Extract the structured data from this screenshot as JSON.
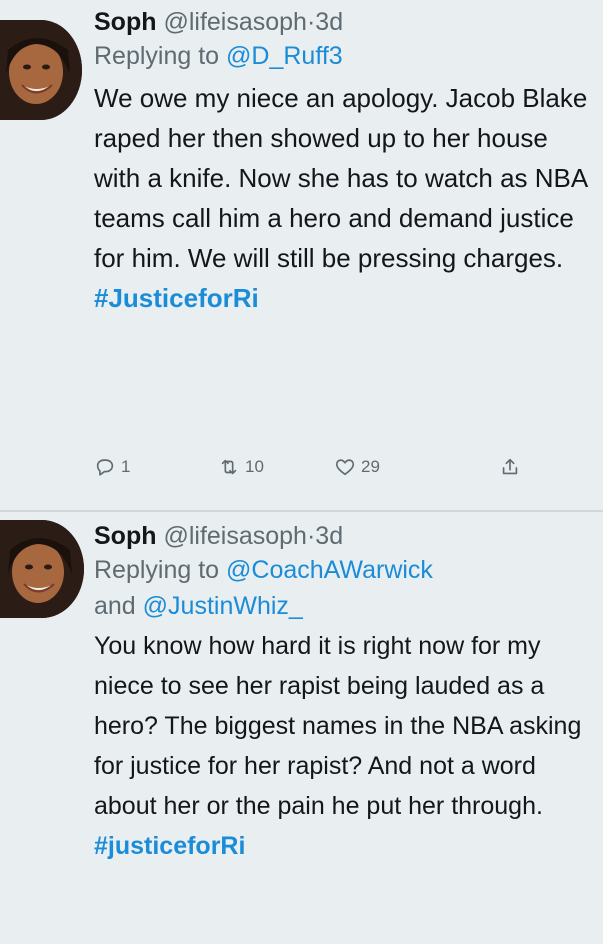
{
  "tweets": [
    {
      "name": "Soph",
      "handle": "@lifeisasoph",
      "separator": "·",
      "time": "3d",
      "replying_prefix": "Replying to ",
      "replying_to": "@D_Ruff3",
      "body": "We owe my niece an apology. Jacob Blake raped her then showed up to her house with a knife. Now she has to watch as NBA teams call him a hero and demand justice for him. We will still be pressing charges.",
      "hashtag": "#JusticeforRi",
      "actions": {
        "replies": "1",
        "retweets": "10",
        "likes": "29"
      }
    },
    {
      "name": "Soph",
      "handle": "@lifeisasoph",
      "separator": "·",
      "time": "3d",
      "replying_prefix": "Replying to ",
      "replying_to": "@CoachAWarwick",
      "replying_and": "and ",
      "replying_to_2": "@JustinWhiz_",
      "body": "You know how hard it is right now for my niece to see her rapist being lauded as a hero? The biggest names in the NBA asking for justice for her rapist? And not a word about her or the pain he put her through.",
      "hashtag": "#justiceforRi"
    }
  ],
  "icons": {
    "reply": "reply-icon",
    "retweet": "retweet-icon",
    "like": "heart-icon",
    "share": "share-icon"
  },
  "colors": {
    "background": "#e9eef0",
    "link": "#1a8cd8",
    "secondary": "#5f6b72",
    "text": "#141618"
  }
}
